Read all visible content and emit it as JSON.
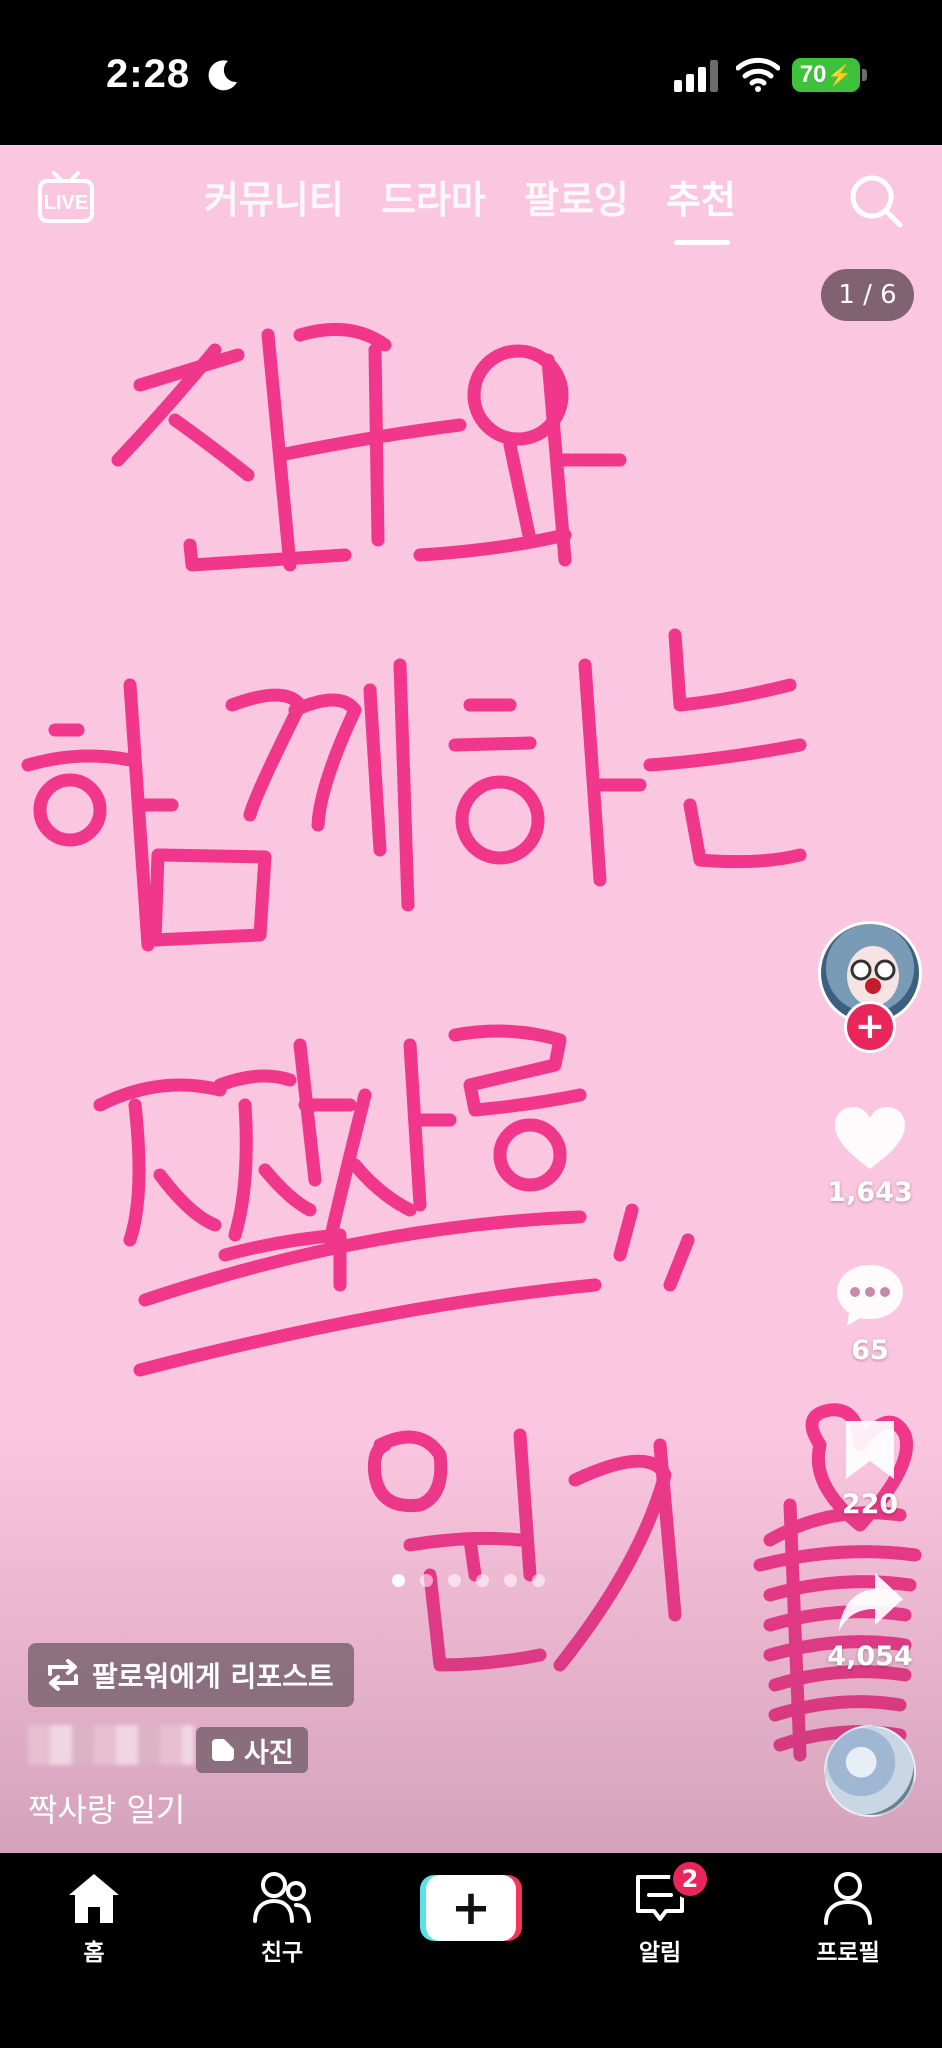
{
  "status_bar": {
    "time": "2:28",
    "battery": "70"
  },
  "top_nav": {
    "tabs": [
      {
        "label": "커뮤니티"
      },
      {
        "label": "드라마"
      },
      {
        "label": "팔로잉"
      },
      {
        "label": "추천",
        "active": true
      }
    ]
  },
  "post": {
    "page_counter": "1 / 6",
    "current_photo": 1,
    "total_photos": 6,
    "repost_label": "팔로워에게 리포스트",
    "photo_badge": "사진",
    "caption": "짝사랑 일기",
    "handwriting_text": [
      "친구와",
      "함께하는",
      "짝사랑",
      "일기"
    ],
    "ink_color": "#f0378b",
    "background_color": "#fbc6df"
  },
  "actions": {
    "likes": "1,643",
    "comments": "65",
    "saves": "220",
    "shares": "4,054"
  },
  "bottom_nav": {
    "home": "홈",
    "friends": "친구",
    "inbox": "알림",
    "inbox_badge": "2",
    "profile": "프로필"
  },
  "colors": {
    "accent": "#e8265a",
    "battery": "#3ec13b",
    "create_cyan": "#5ce0e6",
    "create_red": "#f0355e"
  }
}
